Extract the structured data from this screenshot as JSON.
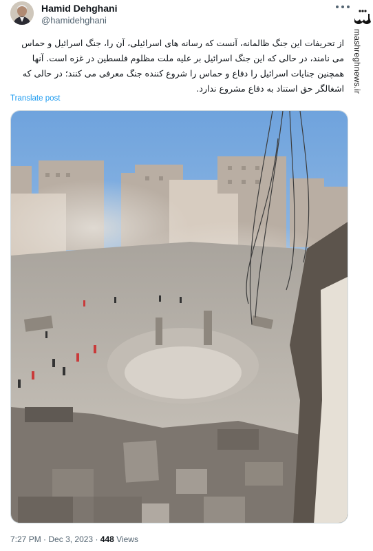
{
  "tweet": {
    "author": {
      "name": "Hamid Dehghani",
      "handle": "@hamidehghani"
    },
    "more_icon": "more-horizontal-icon",
    "text": "از تحریفات این جنگ ظالمانه، آنست که رسانه های اسرائیلی، آن را، جنگ اسرائیل و حماس می نامند، در حالی که این جنگ اسرائیل بر علیه ملت مظلوم فلسطین در غزه است. آنها همچنین جنایات اسرائیل را دفاع و حماس را شروع کننده جنگ معرفی می کنند؛ در حالی که اشغالگر حق استناد به دفاع مشروع ندارد.",
    "translate_label": "Translate post",
    "media": {
      "type": "photo",
      "description_icon": "photo-icon"
    },
    "time": "7:27 PM",
    "separator": "·",
    "date": "Dec 3, 2023",
    "views_count": "448",
    "views_label": "Views"
  },
  "watermark": {
    "logo_text": "مشرق",
    "site": "mashreghnews.ir"
  },
  "colors": {
    "link": "#1d9bf0",
    "text": "#0f1419",
    "secondary": "#536471"
  }
}
